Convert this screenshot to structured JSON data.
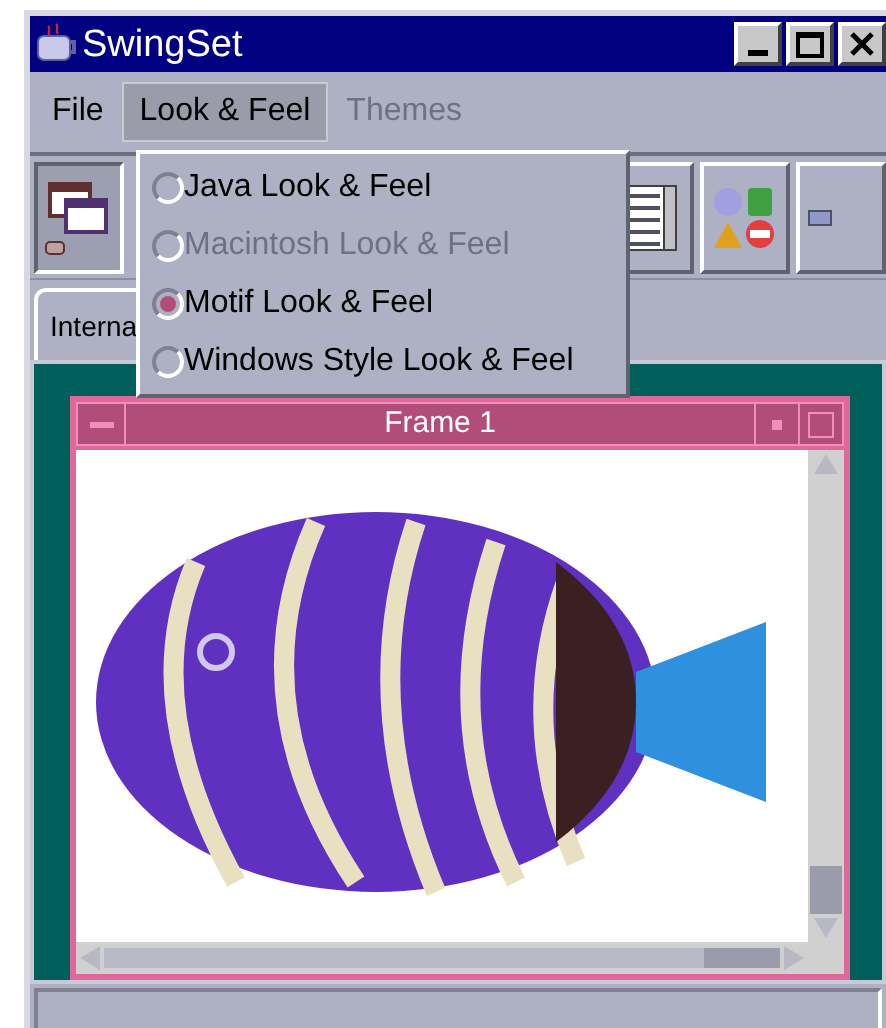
{
  "window": {
    "title": "SwingSet"
  },
  "menu_bar": [
    {
      "label": "File",
      "selected": false,
      "disabled": false
    },
    {
      "label": "Look & Feel",
      "selected": true,
      "disabled": false
    },
    {
      "label": "Themes",
      "selected": false,
      "disabled": true
    }
  ],
  "look_and_feel_menu": [
    {
      "label": "Java Look & Feel",
      "selected": false,
      "disabled": false
    },
    {
      "label": "Macintosh Look & Feel",
      "selected": false,
      "disabled": true
    },
    {
      "label": "Motif Look & Feel",
      "selected": true,
      "disabled": false
    },
    {
      "label": "Windows Style Look & Feel",
      "selected": false,
      "disabled": false
    }
  ],
  "tabs": [
    {
      "label": "Interna",
      "selected": true
    }
  ],
  "internal_frame": {
    "title": "Frame 1"
  }
}
